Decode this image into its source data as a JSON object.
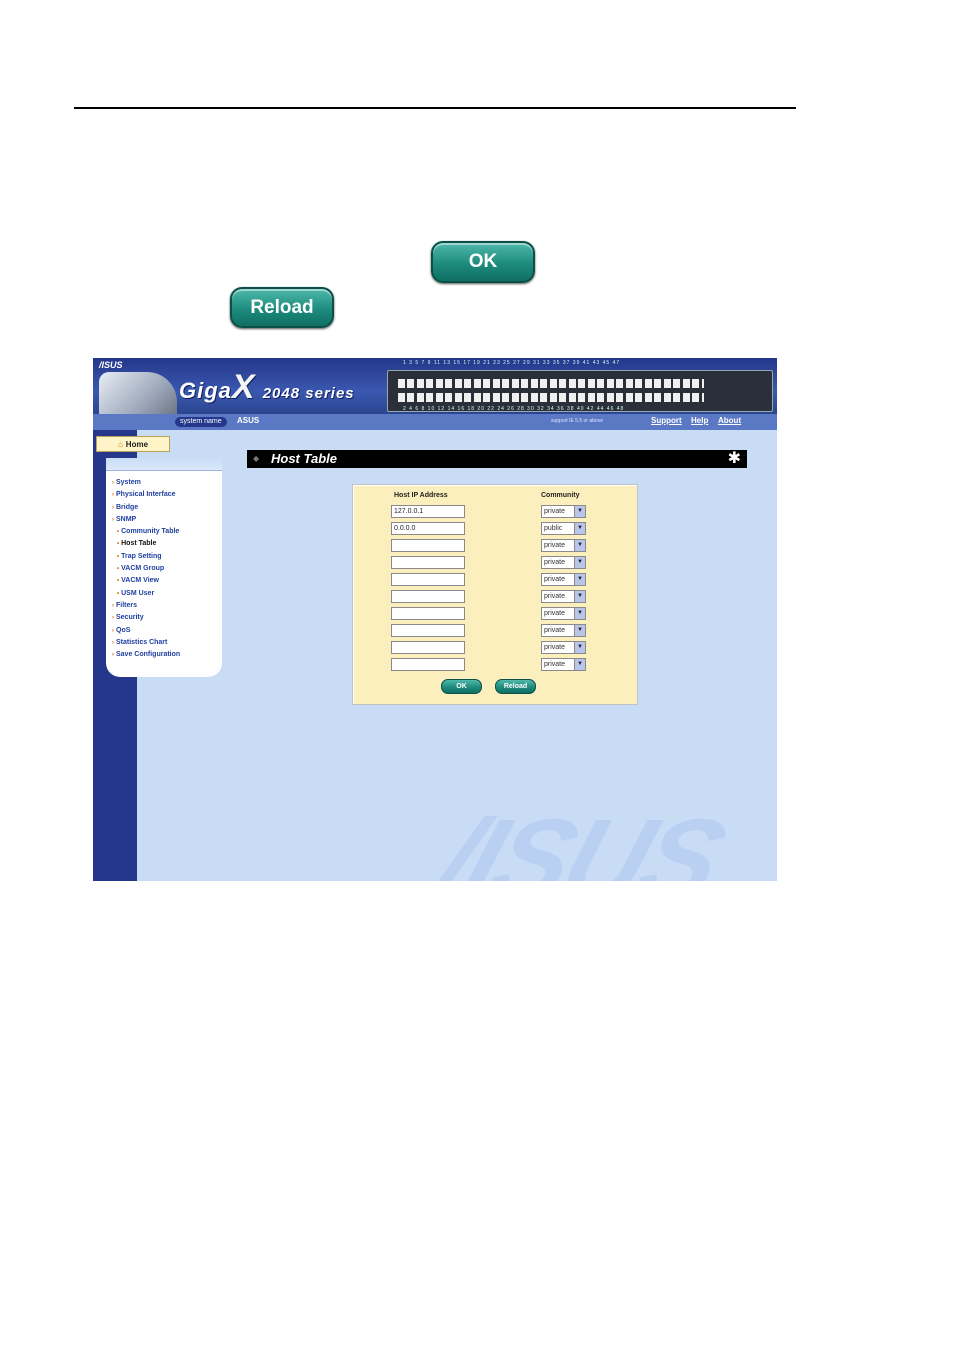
{
  "page": {
    "ok_button_label": "OK",
    "reload_button_label": "Reload"
  },
  "screenshot": {
    "banner": {
      "logo": "/ISUS",
      "brand": "Giga",
      "brand_x": "X",
      "series": "2048 series",
      "port_numbers_top": "1 3 5 7 9 11 13 15 17 19 21 23 25 27 29 31 33 35 37 39 41 43 45 47",
      "port_numbers_bottom": "2 4 6 8 10 12 14 16 18 20 22 24 26 28 30 32 34 36 38 40 42 44 46 48"
    },
    "navbar": {
      "system_name_label": "system name",
      "system_name_value": "ASUS",
      "support_note": "support IE 5.5 or above",
      "links": [
        "Support",
        "Help",
        "About"
      ]
    },
    "home_tab": "Home",
    "menu": [
      {
        "label": "System",
        "sub": false,
        "active": false
      },
      {
        "label": "Physical Interface",
        "sub": false,
        "active": false
      },
      {
        "label": "Bridge",
        "sub": false,
        "active": false
      },
      {
        "label": "SNMP",
        "sub": false,
        "active": false
      },
      {
        "label": "Community Table",
        "sub": true,
        "active": false
      },
      {
        "label": "Host Table",
        "sub": true,
        "active": true
      },
      {
        "label": "Trap Setting",
        "sub": true,
        "active": false
      },
      {
        "label": "VACM Group",
        "sub": true,
        "active": false
      },
      {
        "label": "VACM View",
        "sub": true,
        "active": false
      },
      {
        "label": "USM User",
        "sub": true,
        "active": false
      },
      {
        "label": "Filters",
        "sub": false,
        "active": false
      },
      {
        "label": "Security",
        "sub": false,
        "active": false
      },
      {
        "label": "QoS",
        "sub": false,
        "active": false
      },
      {
        "label": "Statistics Chart",
        "sub": false,
        "active": false
      },
      {
        "label": "Save Configuration",
        "sub": false,
        "active": false
      }
    ],
    "title": "Host Table",
    "table": {
      "headers": {
        "ip": "Host IP Address",
        "community": "Community"
      },
      "rows": [
        {
          "ip": "127.0.0.1",
          "community": "private"
        },
        {
          "ip": "0.0.0.0",
          "community": "public"
        },
        {
          "ip": "",
          "community": "private"
        },
        {
          "ip": "",
          "community": "private"
        },
        {
          "ip": "",
          "community": "private"
        },
        {
          "ip": "",
          "community": "private"
        },
        {
          "ip": "",
          "community": "private"
        },
        {
          "ip": "",
          "community": "private"
        },
        {
          "ip": "",
          "community": "private"
        },
        {
          "ip": "",
          "community": "private"
        }
      ],
      "ok_label": "OK",
      "reload_label": "Reload"
    },
    "watermark": "/ISUS"
  }
}
